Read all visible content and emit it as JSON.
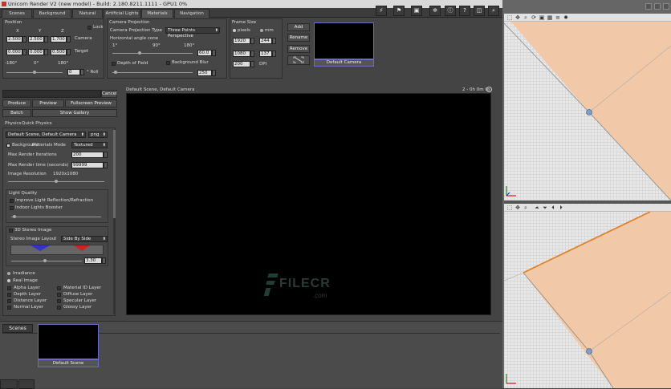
{
  "window": {
    "title": "Unicorn Render V2 (new model) - Build: 2.180.8211.1111 - GPU1 0%"
  },
  "tabs": [
    "Scenes",
    "Background",
    "Natural Lights",
    "Artificial Lights",
    "Materials",
    "Navigation"
  ],
  "position": {
    "title": "Position",
    "x_label": "X",
    "y_label": "Y",
    "z_label": "Z",
    "lock_label": "Lock",
    "camera_label": "Camera",
    "target_label": "Target",
    "cam_x": "2.500",
    "cam_y": "2.500",
    "cam_z": "1.700",
    "tgt_x": "0.000",
    "tgt_y": "0.000",
    "tgt_z": "0.500",
    "angle_min": "-180°",
    "angle_mid": "0°",
    "angle_max": "180°",
    "roll_value": "0",
    "roll_label": "° Roll"
  },
  "camera_projection": {
    "title": "Camera Projection",
    "type_label": "Camera Projection Type",
    "type_value": "Three Points Perspective",
    "angle_label": "Horizontal angle cone",
    "tick1": "1°",
    "tick2": "90°",
    "tick3": "180°",
    "angle_value": "60.0",
    "dof_label": "Depth of Field",
    "blur_label": "Background Blur",
    "blur_value": "250"
  },
  "frame_size": {
    "title": "Frame Size",
    "pixels_label": "pixels",
    "mm_label": "mm",
    "w_px": "1920",
    "w_mm": "244",
    "h_px": "1080",
    "h_mm": "137",
    "dpi_value": "200",
    "dpi_label": "DPI"
  },
  "camera_buttons": {
    "add": "Add",
    "rename": "Rename",
    "remove": "Remove"
  },
  "camera_thumb": {
    "label": "Default Camera"
  },
  "left": {
    "cancel": "Cancel",
    "produce": "Produce",
    "preview": "Preview",
    "fullscreen": "Fullscreen Preview",
    "batch": "Batch",
    "gallery": "Show Gallery",
    "tab_physics": "Physics",
    "tab_quick": "Quick Physics",
    "filename": "Default Scene, Default Camera",
    "format": "png",
    "bg_label": "Background",
    "mat_mode_label": "Materials Mode",
    "mat_mode_value": "Textured",
    "max_iter_label": "Max Render Iterations",
    "max_iter_value": "200",
    "max_time_label": "Max Render time (seconds)",
    "max_time_value": "99999",
    "img_res_label": "Image Resolution",
    "img_res_value": "1920x1080",
    "light_quality": "Light Quality",
    "improve_light": "Improve Light Reflection/Refraction",
    "indoor": "Indoor Lights Booster",
    "stereo": "3D Stereo Image",
    "stereo_layout_label": "Stereo Image Layout",
    "stereo_layout_value": "Side By Side",
    "stereo_value": "3.30",
    "irradiance": "Irradiance",
    "real_image": "Real Image",
    "layers_left": [
      "Alpha Layer",
      "Depth Layer",
      "Distance Layer",
      "Normal Layer"
    ],
    "layers_right": [
      "Material ID Layer",
      "Diffuse Layer",
      "Specular Layer",
      "Glossy Layer"
    ]
  },
  "viewport": {
    "title": "Default Scene, Default Camera",
    "timer": "2 - 0h 0m 0s",
    "watermark": "FILECR",
    ".com": ".com"
  },
  "scenes": {
    "title": "Scenes",
    "thumb_label": "Default Scene"
  }
}
